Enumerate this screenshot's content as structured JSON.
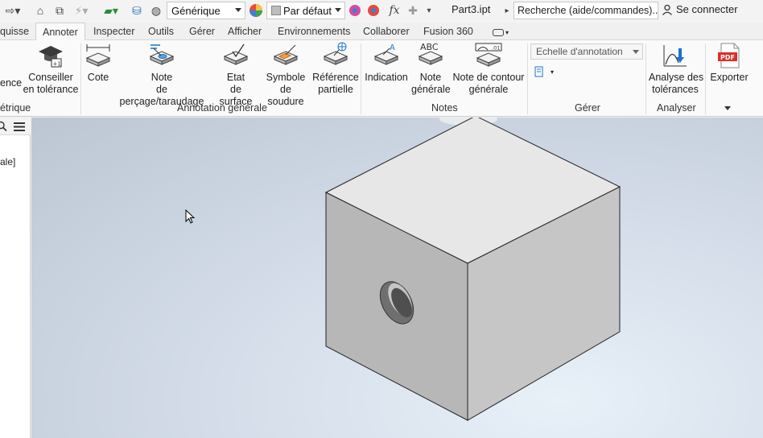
{
  "qat": {
    "material": "Générique",
    "appearance": "Par défaut",
    "function_symbol": "fx",
    "document_title": "Part3.ipt",
    "search_placeholder": "Recherche (aide/commandes)...",
    "signin": "Se connecter"
  },
  "tabs": [
    {
      "label": "quisse"
    },
    {
      "label": "Annoter",
      "active": true
    },
    {
      "label": "Inspecter"
    },
    {
      "label": "Outils"
    },
    {
      "label": "Gérer"
    },
    {
      "label": "Afficher"
    },
    {
      "label": "Environnements"
    },
    {
      "label": "Collaborer"
    },
    {
      "label": "Fusion 360"
    }
  ],
  "ribbon": {
    "buttons": {
      "cut_left": "ence",
      "conseiller_l1": "Conseiller",
      "conseiller_l2": "en tolérance",
      "cote": "Cote",
      "note_percage_l1": "Note",
      "note_percage_l2": "de perçage/taraudage",
      "etat_surface_l1": "Etat",
      "etat_surface_l2": "de surface",
      "symbole_soudure_l1": "Symbole",
      "symbole_soudure_l2": "de soudure",
      "reference_l1": "Référence",
      "reference_l2": "partielle",
      "indication": "Indication",
      "note_generale_l1": "Note",
      "note_generale_l2": "générale",
      "note_contour_l1": "Note de contour",
      "note_contour_l2": "générale",
      "analyse_l1": "Analyse des",
      "analyse_l2": "tolérances",
      "exporter": "Exporter",
      "abc_text": "ABC",
      "pdf_text": "PDF"
    },
    "panels": {
      "geometric_cut": "étrique",
      "annotation_generale": "Annotation générale",
      "notes": "Notes",
      "gerer": "Gérer",
      "analyser": "Analyser"
    },
    "scale_dropdown": "Echelle d'annotation"
  },
  "browser": {
    "visible_text": "ale]"
  },
  "colors": {
    "accent_blue": "#1a73c9",
    "cube_top": "#e7e7e7",
    "cube_left": "#b7b7b7",
    "cube_right": "#c6c6c6"
  }
}
